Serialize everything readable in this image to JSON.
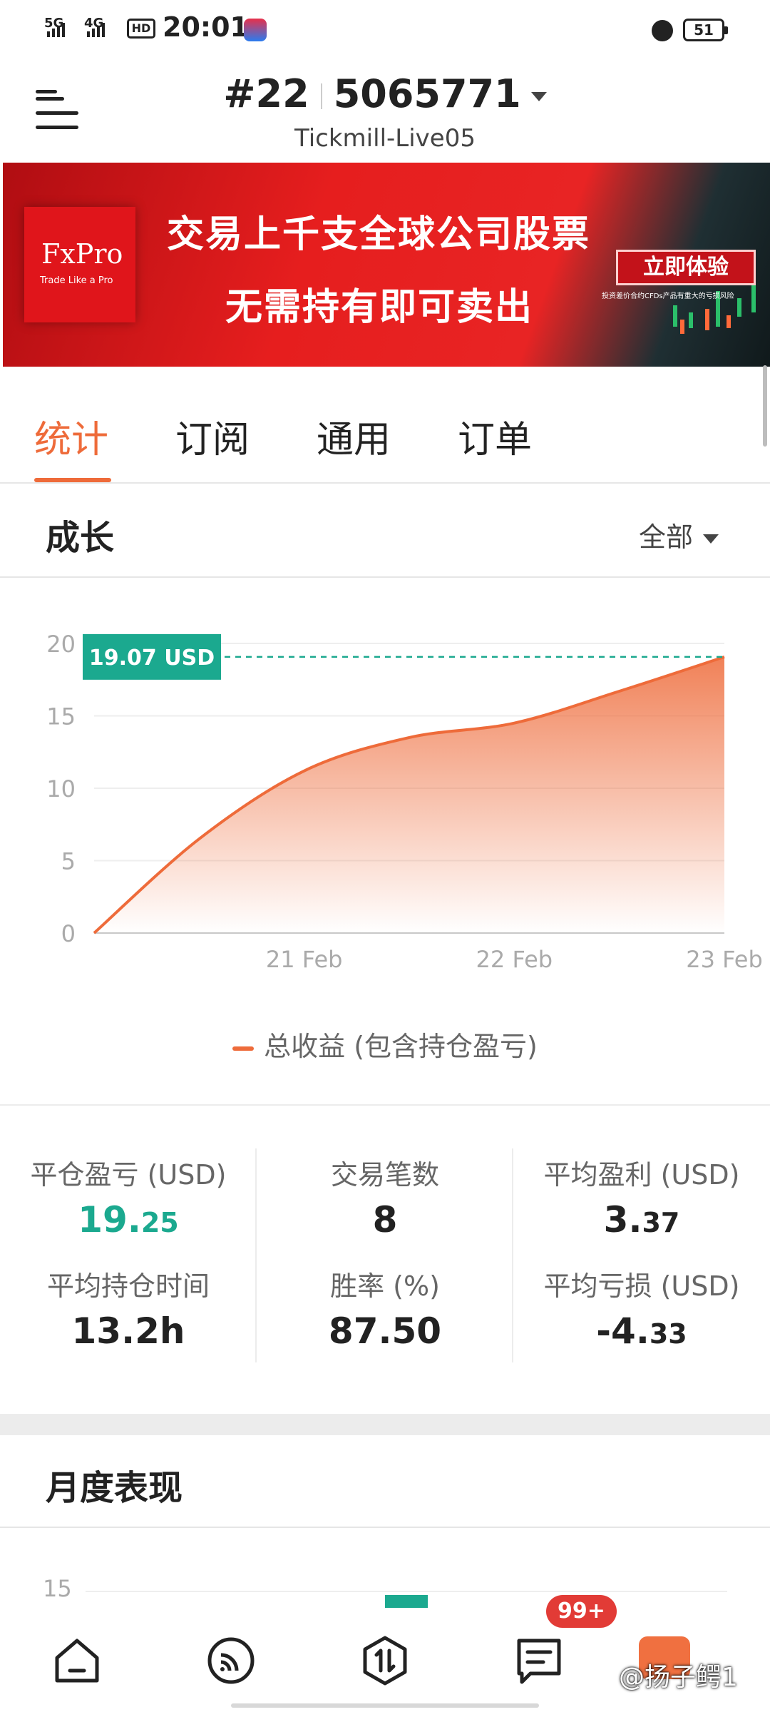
{
  "status_bar": {
    "network1": "5G",
    "network2": "4G",
    "hd": "HD",
    "time": "20:01",
    "battery": "51"
  },
  "header": {
    "account_prefix": "#22",
    "account_number": "5065771",
    "server": "Tickmill-Live05"
  },
  "banner": {
    "brand": "FxPro",
    "tagline": "Trade Like a Pro",
    "line1": "交易上千支全球公司股票",
    "line2": "无需持有即可卖出",
    "cta": "立即体验",
    "note": "投资差价合约CFDs产品有重大的亏损风险"
  },
  "tabs": [
    "统计",
    "订阅",
    "通用",
    "订单"
  ],
  "active_tab": 0,
  "growth": {
    "title": "成长",
    "filter": "全部",
    "legend": "总收益 (包含持仓盈亏)"
  },
  "chart_data": {
    "type": "area",
    "x": [
      "20 Feb",
      "20.5 Feb",
      "21 Feb",
      "21.5 Feb",
      "22 Feb",
      "22.5 Feb",
      "23 Feb"
    ],
    "x_tick_labels": [
      "21 Feb",
      "22 Feb",
      "23 Feb"
    ],
    "y_ticks": [
      0,
      5,
      10,
      15,
      20
    ],
    "ylim": [
      0,
      20
    ],
    "series": [
      {
        "name": "总收益 (包含持仓盈亏)",
        "values": [
          0,
          6.5,
          11.2,
          13.5,
          14.5,
          16.7,
          19.07
        ]
      }
    ],
    "current_value_label": "19.07 USD",
    "line_color": "#ee6b3a",
    "label_color": "#1ba98f"
  },
  "stats": {
    "closed_pnl_label": "平仓盈亏 (USD)",
    "closed_pnl_int": "19.",
    "closed_pnl_dec": "25",
    "trades_label": "交易笔数",
    "trades_value": "8",
    "avg_profit_label": "平均盈利 (USD)",
    "avg_profit_int": "3.",
    "avg_profit_dec": "37",
    "avg_hold_label": "平均持仓时间",
    "avg_hold_value": "13.2h",
    "win_rate_label": "胜率 (%)",
    "win_rate_value": "87.50",
    "avg_loss_label": "平均亏损 (USD)",
    "avg_loss_int": "-4.",
    "avg_loss_dec": "33"
  },
  "monthly": {
    "title": "月度表现",
    "tick": "15"
  },
  "bottom_nav": {
    "badge": "99+",
    "watermark": "@扬子鳄1"
  },
  "colors": {
    "accent": "#ee6b3a",
    "positive": "#1ba98f",
    "badge": "#e23b36"
  }
}
